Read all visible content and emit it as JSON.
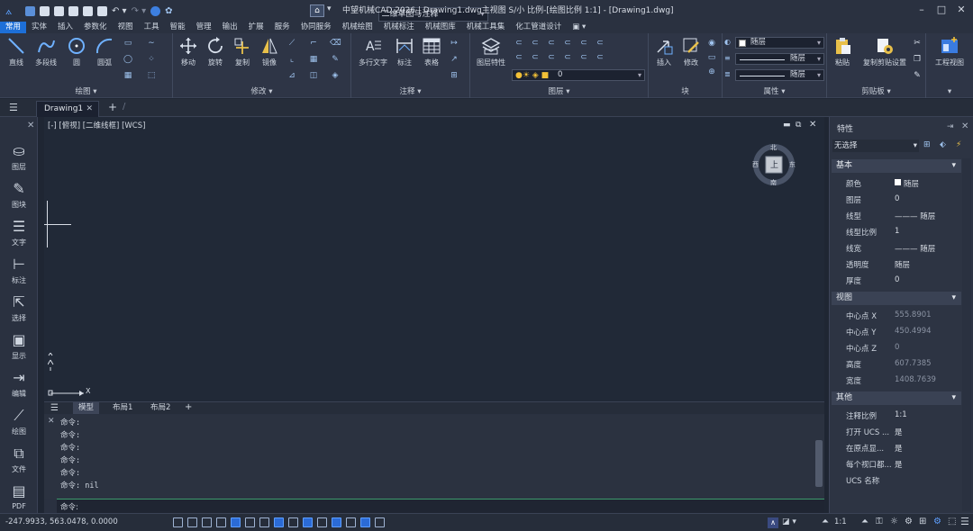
{
  "window": {
    "title": "中望机械CAD 2026 | Drawing1.dwg主视图 S/小 比例-[绘图比例 1:1] - [Drawing1.dwg]",
    "workspace": "二维草图与注释",
    "controls": [
      "–",
      "□",
      "✕"
    ]
  },
  "menu": {
    "items": [
      "常用",
      "实体",
      "插入",
      "参数化",
      "视图",
      "工具",
      "智能",
      "管理",
      "输出",
      "扩展",
      "服务",
      "协同服务",
      "机械绘图",
      "机械标注",
      "机械图库",
      "机械工具集",
      "化工管道设计"
    ],
    "active": 0
  },
  "ribbon": {
    "draw": {
      "label": "绘图",
      "buttons": [
        "直线",
        "多段线",
        "圆",
        "圆弧"
      ]
    },
    "modify": {
      "label": "修改",
      "buttons": [
        "移动",
        "旋转",
        "复制",
        "镜像"
      ]
    },
    "annotate": {
      "label": "注释",
      "buttons": [
        "多行文字",
        "标注",
        "表格"
      ]
    },
    "layers": {
      "label": "图层",
      "buttons": [
        "图层特性"
      ],
      "current_layer": "0"
    },
    "block": {
      "label": "块",
      "buttons": [
        "插入",
        "修改"
      ],
      "sub": "块"
    },
    "properties": {
      "label": "属性",
      "color": "随层",
      "linetype": "随层",
      "lineweight": "随层"
    },
    "clipboard": {
      "label": "剪贴板",
      "buttons": [
        "粘贴",
        "复制剪贴设置"
      ]
    },
    "view": {
      "label": "",
      "buttons": [
        "工程视图"
      ]
    }
  },
  "tabs": {
    "doc": "Drawing1",
    "add": "+"
  },
  "toolpalette": {
    "items": [
      "图层",
      "图块",
      "文字",
      "标注",
      "选择",
      "显示",
      "编辑",
      "绘图",
      "文件",
      "PDF"
    ]
  },
  "canvas": {
    "viewport_label": "[-] [俯视] [二维线框] [WCS]",
    "viewcube": {
      "top": "上",
      "n": "北",
      "s": "南",
      "e": "东",
      "w": "西"
    },
    "ucs_x": "X",
    "ucs_y": "Y"
  },
  "layout_tabs": {
    "items": [
      "模型",
      "布局1",
      "布局2"
    ],
    "add": "+"
  },
  "command": {
    "history": [
      "命令:",
      "命令:",
      "命令:",
      "命令:",
      "命令:",
      "命令: nil"
    ],
    "prompt": "命令:"
  },
  "properties": {
    "title": "特性",
    "selection": "无选择",
    "sections": [
      {
        "name": "基本",
        "rows": [
          {
            "k": "颜色",
            "v": "随层",
            "swatch": "#ffffff"
          },
          {
            "k": "图层",
            "v": "0"
          },
          {
            "k": "线型",
            "v": "——— 随层"
          },
          {
            "k": "线型比例",
            "v": "1"
          },
          {
            "k": "线宽",
            "v": "——— 随层"
          },
          {
            "k": "透明度",
            "v": "随层"
          },
          {
            "k": "厚度",
            "v": "0"
          }
        ]
      },
      {
        "name": "视图",
        "rows": [
          {
            "k": "中心点 X",
            "v": "555.8901"
          },
          {
            "k": "中心点 Y",
            "v": "450.4994"
          },
          {
            "k": "中心点 Z",
            "v": "0"
          },
          {
            "k": "高度",
            "v": "607.7385"
          },
          {
            "k": "宽度",
            "v": "1408.7639"
          }
        ]
      },
      {
        "name": "其他",
        "rows": [
          {
            "k": "注释比例",
            "v": "1:1"
          },
          {
            "k": "打开 UCS ...",
            "v": "是"
          },
          {
            "k": "在原点显...",
            "v": "是"
          },
          {
            "k": "每个视口都...",
            "v": "是"
          },
          {
            "k": "UCS 名称",
            "v": ""
          }
        ]
      }
    ]
  },
  "status": {
    "coords": "-247.9933, 563.0478, 0.0000",
    "scale": "1:1"
  }
}
